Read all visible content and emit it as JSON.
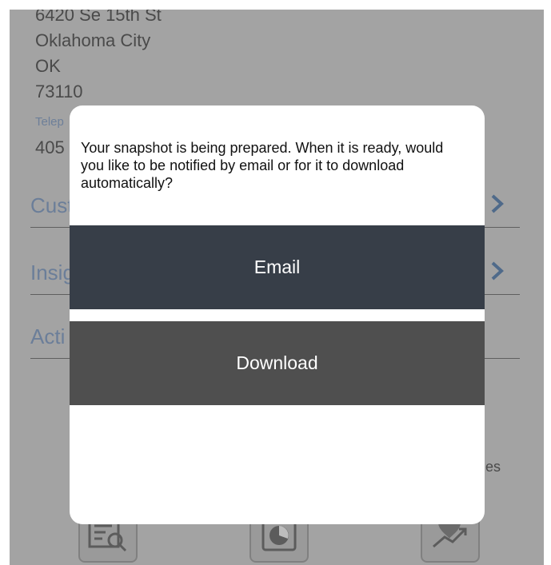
{
  "background": {
    "address_lines": [
      "6420 Se 15th St",
      "Oklahoma City",
      "OK",
      "73110"
    ],
    "telephone_label": "Telep",
    "telephone_value": "405",
    "rows": [
      {
        "label": "Cust",
        "has_chevron": true
      },
      {
        "label": "Insig",
        "has_chevron": true
      },
      {
        "label": "Acti",
        "has_chevron": false
      }
    ],
    "side_text": "es",
    "tiles": [
      {
        "icon": "document-search-icon"
      },
      {
        "icon": "pie-chart-icon"
      },
      {
        "icon": "trend-up-icon"
      }
    ]
  },
  "dialog": {
    "message": "Your snapshot is being prepared. When it is ready, would you like to be notified by email or for it to download automatically?",
    "email_button_label": "Email",
    "download_button_label": "Download"
  },
  "colors": {
    "email_button_bg": "#373e48",
    "download_button_bg": "#4f4f4f",
    "overlay": "#a3a3a3",
    "accent_blue": "#6b7e99"
  }
}
